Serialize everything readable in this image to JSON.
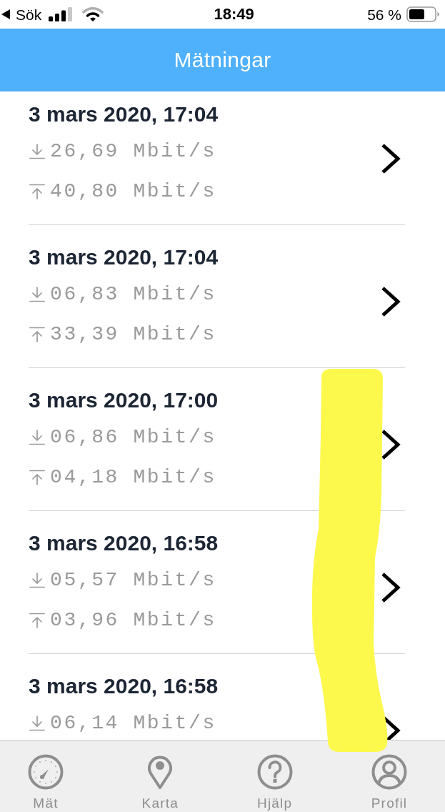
{
  "status_bar": {
    "back_label": "Sök",
    "time": "18:49",
    "battery": "56 %"
  },
  "header": {
    "title": "Mätningar"
  },
  "measurements": [
    {
      "time": "3 mars 2020, 17:04",
      "download": "26,69 Mbit/s",
      "upload": "40,80 Mbit/s"
    },
    {
      "time": "3 mars 2020, 17:04",
      "download": "06,83 Mbit/s",
      "upload": "33,39 Mbit/s"
    },
    {
      "time": "3 mars 2020, 17:00",
      "download": "06,86 Mbit/s",
      "upload": "04,18 Mbit/s"
    },
    {
      "time": "3 mars 2020, 16:58",
      "download": "05,57 Mbit/s",
      "upload": "03,96 Mbit/s"
    },
    {
      "time": "3 mars 2020, 16:58",
      "download": "06,14 Mbit/s"
    }
  ],
  "tab_bar": {
    "items": [
      {
        "label": "Mät"
      },
      {
        "label": "Karta"
      },
      {
        "label": "Hjälp"
      },
      {
        "label": "Profil"
      }
    ]
  }
}
